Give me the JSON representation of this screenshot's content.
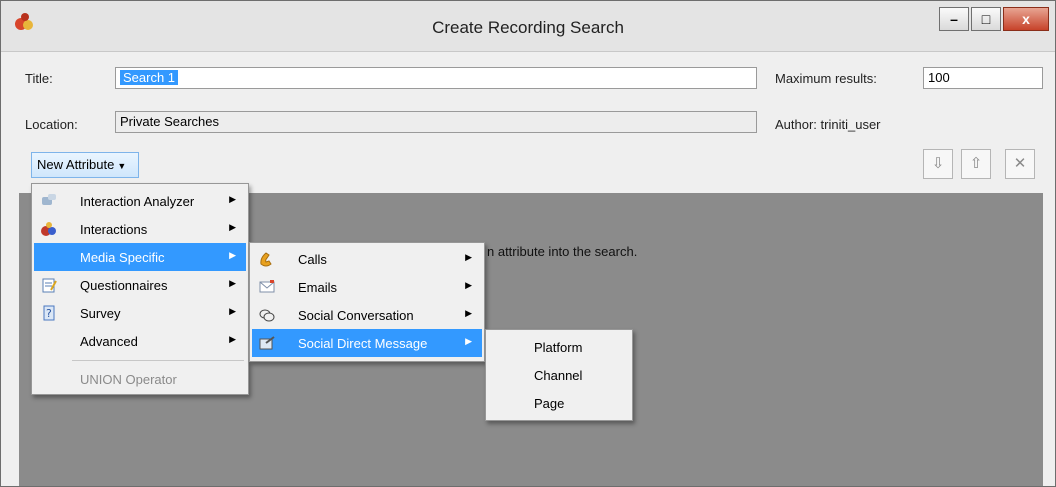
{
  "window": {
    "title": "Create Recording Search",
    "min_glyph": "–",
    "max_glyph": "□",
    "close_glyph": "x"
  },
  "form": {
    "title_label": "Title:",
    "title_value": "Search 1",
    "location_label": "Location:",
    "location_value": "Private Searches",
    "max_results_label": "Maximum results:",
    "max_results_value": "100",
    "author_label": "Author:",
    "author_value": "triniti_user"
  },
  "toolbar": {
    "new_attribute_label": "New Attribute",
    "move_down_icon": "arrow-down-icon",
    "move_up_icon": "arrow-up-icon",
    "remove_icon": "remove-x-icon",
    "down_glyph": "⇩",
    "up_glyph": "⇧",
    "remove_glyph": "✕"
  },
  "content": {
    "hint_text": "n attribute into the search."
  },
  "menu1": {
    "items": [
      {
        "label": "Interaction Analyzer",
        "icon": "interaction-analyzer-icon",
        "has_submenu": true
      },
      {
        "label": "Interactions",
        "icon": "interactions-icon",
        "has_submenu": true
      },
      {
        "label": "Media Specific",
        "icon": "",
        "has_submenu": true,
        "highlighted": true
      },
      {
        "label": "Questionnaires",
        "icon": "questionnaires-icon",
        "has_submenu": true
      },
      {
        "label": "Survey",
        "icon": "survey-icon",
        "has_submenu": true
      },
      {
        "label": "Advanced",
        "icon": "",
        "has_submenu": true
      },
      {
        "label": "UNION Operator",
        "icon": "",
        "has_submenu": false,
        "disabled": true
      }
    ]
  },
  "menu2": {
    "items": [
      {
        "label": "Calls",
        "icon": "phone-icon",
        "has_submenu": true
      },
      {
        "label": "Emails",
        "icon": "email-icon",
        "has_submenu": true
      },
      {
        "label": "Social Conversation",
        "icon": "social-conversation-icon",
        "has_submenu": true
      },
      {
        "label": "Social Direct Message",
        "icon": "social-direct-message-icon",
        "has_submenu": true,
        "highlighted": true
      }
    ]
  },
  "menu3": {
    "items": [
      {
        "label": "Platform"
      },
      {
        "label": "Channel"
      },
      {
        "label": "Page"
      }
    ]
  },
  "colors": {
    "highlight": "#3399ff",
    "content_bg": "#8b8b8b",
    "close_button": "#c7432a"
  }
}
